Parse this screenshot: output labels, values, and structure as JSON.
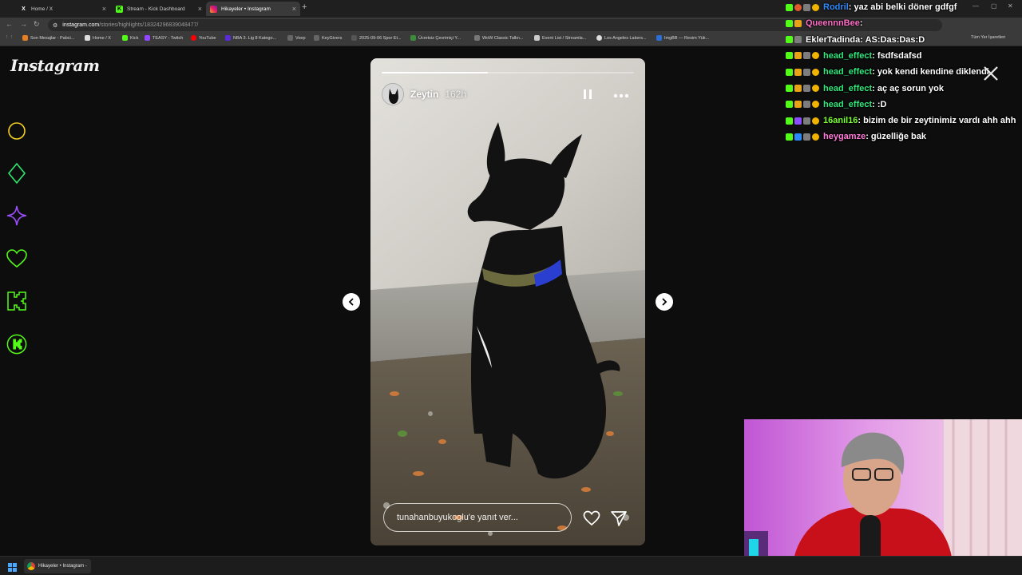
{
  "browser": {
    "tabs": [
      {
        "label": "Home / X",
        "icon": "x-logo-icon"
      },
      {
        "label": "Stream - Kick Dashboard",
        "icon": "kick-logo-icon"
      },
      {
        "label": "Hikayeler • Instagram",
        "icon": "instagram-logo-icon",
        "active": true
      }
    ],
    "new_tab": "+",
    "url_host": "instagram.com",
    "url_path": "/stories/highlights/18324296839048477/",
    "bookmarks": [
      "Son Mesajlar - Pabci...",
      "Home / X",
      "Kick",
      "TEASY - Twitch",
      "YouTube",
      "NBA 3. Lig 8 Katego...",
      "Voep",
      "KeyGivers",
      "2025-09-06 Spor Et...",
      "Ücretsiz Çevrimiçi Y...",
      "WoW Classic Talkn...",
      "Event List / Streamla...",
      "Los Angeles Lakers...",
      "ImgBB — Resim Yük..."
    ],
    "bookmarks_right": "Tüm Yer İşaretleri"
  },
  "instagram": {
    "logo": "Instagram",
    "sidebar_icons": [
      "circle-icon",
      "diamond-icon",
      "sparkle-icon",
      "heart-icon",
      "kick-k-icon",
      "kick-badge-icon"
    ],
    "story": {
      "username": "Zeytin",
      "time": "162h",
      "progress": 0.42,
      "reply_placeholder": "tunahanbuyukoglu'e yanıt ver...",
      "pause_icon": "pause-icon",
      "more_icon": "more-icon"
    }
  },
  "chat": {
    "messages": [
      {
        "user": "Rodril",
        "text": ": yaz abi belki döner gdfgf",
        "color": "#2f8cff",
        "badges": [
          "k",
          "r",
          "g",
          "y"
        ]
      },
      {
        "user": "QueennnBee",
        "text": ":",
        "color": "#ff6ec7",
        "badges": [
          "k",
          "o"
        ]
      },
      {
        "user": "EklerTadinda",
        "text": ": AS:Das:Das:D",
        "color": "#ffffff",
        "badges": [
          "k",
          "g"
        ]
      },
      {
        "user": "head_effect",
        "text": ": fsdfsdafsd",
        "color": "#2fe87c",
        "badges": [
          "k",
          "o",
          "g",
          "y"
        ]
      },
      {
        "user": "head_effect",
        "text": ": yok kendi kendine diklendi",
        "color": "#2fe87c",
        "badges": [
          "k",
          "o",
          "g",
          "y"
        ]
      },
      {
        "user": "head_effect",
        "text": ": aç aç sorun yok",
        "color": "#2fe87c",
        "badges": [
          "k",
          "o",
          "g",
          "y"
        ]
      },
      {
        "user": "head_effect",
        "text": ": :D",
        "color": "#2fe87c",
        "badges": [
          "k",
          "o",
          "g",
          "y"
        ]
      },
      {
        "user": "16anil16",
        "text": ": bizim de bir zeytinimiz vardı ahh ahh",
        "color": "#7cff2f",
        "badges": [
          "k",
          "p",
          "g",
          "y"
        ]
      },
      {
        "user": "heygamze",
        "text": ": güzelliğe bak",
        "color": "#ff7ad9",
        "badges": [
          "k",
          "b",
          "g",
          "y"
        ]
      }
    ]
  },
  "taskbar": {
    "start_icon": "windows-start-icon",
    "active_window": "Hikayeler • Instagram -"
  },
  "colors": {
    "kick_green": "#53fc18",
    "sidebar_yellow": "#f5d020",
    "sidebar_purple": "#9b4dff"
  }
}
